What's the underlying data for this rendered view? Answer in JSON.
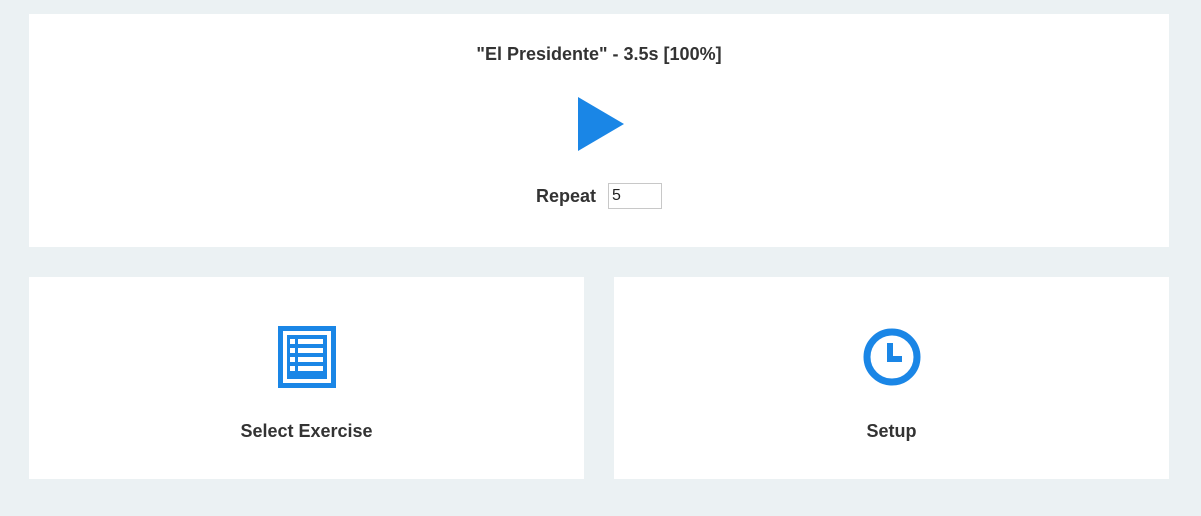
{
  "player": {
    "title": "\"El Presidente\" - 3.5s [100%]",
    "play_icon": "play-icon",
    "repeat_label": "Repeat",
    "repeat_value": "5"
  },
  "nav": {
    "select_exercise": {
      "label": "Select Exercise",
      "icon": "list-icon"
    },
    "setup": {
      "label": "Setup",
      "icon": "clock-icon"
    }
  },
  "colors": {
    "background": "#ebf1f3",
    "card": "#ffffff",
    "accent": "#1a86e6",
    "text": "#333333"
  }
}
